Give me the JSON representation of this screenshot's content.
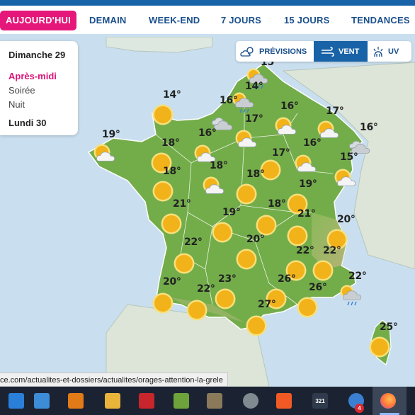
{
  "nav": {
    "tabs": [
      {
        "label": "AUJOURD'HUI",
        "active": true
      },
      {
        "label": "DEMAIN",
        "active": false
      },
      {
        "label": "WEEK-END",
        "active": false
      },
      {
        "label": "7 JOURS",
        "active": false
      },
      {
        "label": "15 JOURS",
        "active": false
      },
      {
        "label": "TENDANCES",
        "active": false
      }
    ]
  },
  "day_panel": {
    "day1": "Dimanche 29",
    "periods": [
      {
        "label": "Après-midi",
        "active": true
      },
      {
        "label": "Soirée",
        "active": false
      },
      {
        "label": "Nuit",
        "active": false
      }
    ],
    "day2": "Lundi 30"
  },
  "modes": [
    {
      "label": "PRÉVISIONS",
      "icon": "partly-cloudy-icon",
      "active": false
    },
    {
      "label": "VENT",
      "icon": "wind-icon",
      "active": true
    },
    {
      "label": "UV",
      "icon": "uv-icon",
      "active": false
    }
  ],
  "weather": [
    {
      "temp": "15°",
      "icon": "rain-icon"
    },
    {
      "temp": "14°",
      "icon": "rain-icon"
    },
    {
      "temp": "14°",
      "icon": "sun-icon"
    },
    {
      "temp": "16°",
      "icon": "cloudy-icon"
    },
    {
      "temp": "16°",
      "icon": "partly-cloudy-icon"
    },
    {
      "temp": "17°",
      "icon": "partly-cloudy-icon"
    },
    {
      "temp": "16°",
      "icon": "cloudy-icon"
    },
    {
      "temp": "19°",
      "icon": "partly-cloudy-icon"
    },
    {
      "temp": "16°",
      "icon": "partly-cloudy-icon"
    },
    {
      "temp": "17°",
      "icon": "partly-cloudy-icon"
    },
    {
      "temp": "18°",
      "icon": "sun-icon"
    },
    {
      "temp": "17°",
      "icon": "sun-icon"
    },
    {
      "temp": "16°",
      "icon": "partly-cloudy-icon"
    },
    {
      "temp": "15°",
      "icon": "partly-cloudy-icon"
    },
    {
      "temp": "18°",
      "icon": "sun-icon"
    },
    {
      "temp": "18°",
      "icon": "partly-cloudy-icon"
    },
    {
      "temp": "18°",
      "icon": "sun-icon"
    },
    {
      "temp": "19°",
      "icon": "sun-icon"
    },
    {
      "temp": "21°",
      "icon": "sun-icon"
    },
    {
      "temp": "19°",
      "icon": "sun-icon"
    },
    {
      "temp": "18°",
      "icon": "sun-icon"
    },
    {
      "temp": "21°",
      "icon": "sun-icon"
    },
    {
      "temp": "20°",
      "icon": "sun-icon"
    },
    {
      "temp": "22°",
      "icon": "sun-icon"
    },
    {
      "temp": "20°",
      "icon": "sun-icon"
    },
    {
      "temp": "22°",
      "icon": "sun-icon"
    },
    {
      "temp": "22°",
      "icon": "sun-icon"
    },
    {
      "temp": "20°",
      "icon": "sun-icon"
    },
    {
      "temp": "22°",
      "icon": "sun-icon"
    },
    {
      "temp": "23°",
      "icon": "sun-icon"
    },
    {
      "temp": "26°",
      "icon": "sun-icon"
    },
    {
      "temp": "26°",
      "icon": "sun-icon"
    },
    {
      "temp": "22°",
      "icon": "rain-icon"
    },
    {
      "temp": "27°",
      "icon": "sun-icon"
    },
    {
      "temp": "25°",
      "icon": "sun-icon"
    }
  ],
  "status_url": "ce.com/actualites-et-dossiers/actualites/orages-attention-la-grele",
  "taskbar": {
    "apps": [
      {
        "name": "download-icon",
        "color": "#2a7fd9"
      },
      {
        "name": "store-icon",
        "color": "#3c8cd8"
      },
      {
        "name": "xnview-icon",
        "color": "#e07b18"
      },
      {
        "name": "folder-icon",
        "color": "#e8b43a"
      },
      {
        "name": "filezilla-icon",
        "color": "#c8262c"
      },
      {
        "name": "notepad-icon",
        "color": "#6da33a"
      },
      {
        "name": "paint-icon",
        "color": "#8a7a5a"
      },
      {
        "name": "eye-icon",
        "color": "#7f8a91"
      },
      {
        "name": "brave-icon",
        "color": "#f15a24"
      },
      {
        "name": "calendar-icon",
        "color": "#2f3a4c"
      },
      {
        "name": "weather-icon",
        "color": "#3b7fd3"
      },
      {
        "name": "firefox-icon",
        "color": "#ff7139"
      }
    ],
    "calendar_text": "321",
    "badge_count": "4"
  },
  "colors": {
    "accent_blue": "#1862a8",
    "active_pink": "#e6177a",
    "sea": "#c9dfef",
    "land": "#74b04a"
  }
}
